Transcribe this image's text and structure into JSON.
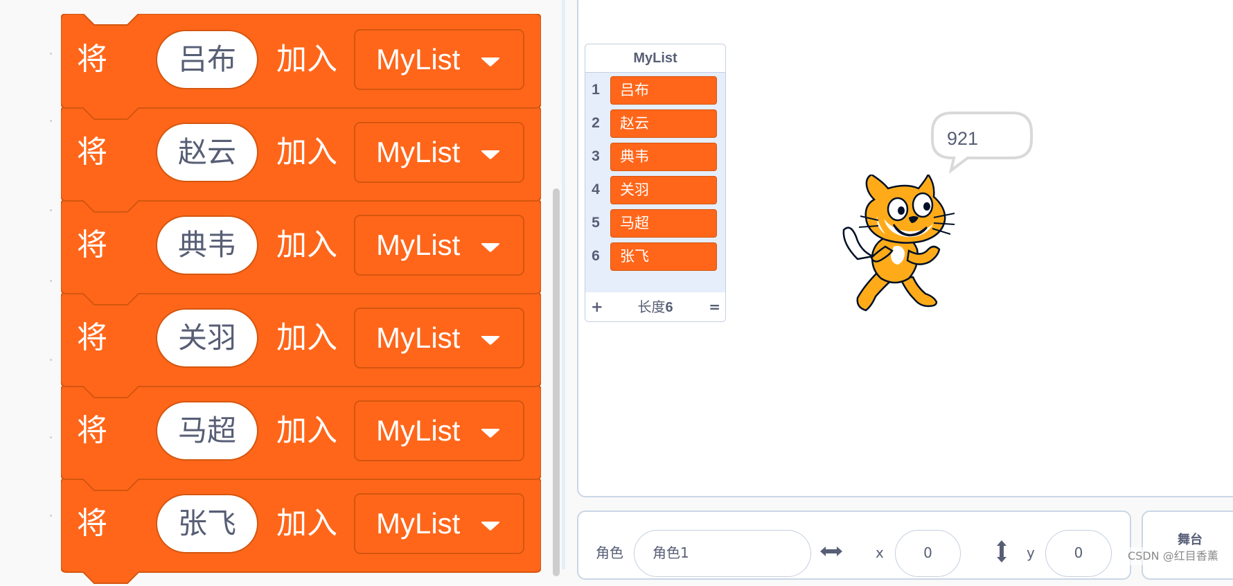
{
  "code_blocks": [
    {
      "verb": "将",
      "item": "吕布",
      "join": "加入",
      "list": "MyList"
    },
    {
      "verb": "将",
      "item": "赵云",
      "join": "加入",
      "list": "MyList"
    },
    {
      "verb": "将",
      "item": "典韦",
      "join": "加入",
      "list": "MyList"
    },
    {
      "verb": "将",
      "item": "关羽",
      "join": "加入",
      "list": "MyList"
    },
    {
      "verb": "将",
      "item": "马超",
      "join": "加入",
      "list": "MyList"
    },
    {
      "verb": "将",
      "item": "张飞",
      "join": "加入",
      "list": "MyList"
    }
  ],
  "list_monitor": {
    "title": "MyList",
    "items": [
      {
        "index": "1",
        "value": "吕布"
      },
      {
        "index": "2",
        "value": "赵云"
      },
      {
        "index": "3",
        "value": "典韦"
      },
      {
        "index": "4",
        "value": "关羽"
      },
      {
        "index": "5",
        "value": "马超"
      },
      {
        "index": "6",
        "value": "张飞"
      }
    ],
    "add_symbol": "+",
    "length_label": "长度",
    "length_value": "6",
    "resize_symbol": "="
  },
  "speech_bubble": {
    "text": "921"
  },
  "sprite_info": {
    "sprite_label": "角色",
    "sprite_name": "角色1",
    "x_label": "x",
    "x_value": "0",
    "y_label": "y",
    "y_value": "0"
  },
  "stage_panel": {
    "label": "舞台"
  },
  "watermark": "CSDN @红目香薰",
  "colors": {
    "block_fill": "#ff661a",
    "block_border": "#d4560f",
    "text_gray": "#575e75",
    "stage_border": "#c9d6e6",
    "monitor_bg": "#e5eefa"
  },
  "icons": {
    "dropdown": "dropdown-arrow-icon",
    "x_axis": "horizontal-arrows-icon",
    "y_axis": "vertical-arrows-icon"
  }
}
